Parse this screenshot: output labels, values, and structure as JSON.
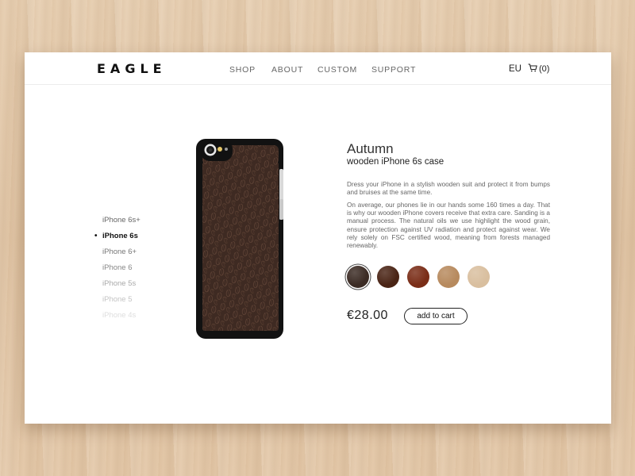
{
  "header": {
    "logo": "EAGLE",
    "nav": [
      "SHOP",
      "ABOUT",
      "CUSTOM",
      "SUPPORT"
    ],
    "region": "EU",
    "cart_count": "(0)"
  },
  "models": [
    {
      "label": "iPhone 6s+",
      "selected": false
    },
    {
      "label": "iPhone 6s",
      "selected": true
    },
    {
      "label": "iPhone 6+",
      "selected": false
    },
    {
      "label": "iPhone 6",
      "selected": false
    },
    {
      "label": "iPhone 5s",
      "selected": false
    },
    {
      "label": "iPhone 5",
      "selected": false
    },
    {
      "label": "iPhone 4s",
      "selected": false
    }
  ],
  "product": {
    "title": "Autumn",
    "subtitle": "wooden iPhone 6s case",
    "description_1": "Dress your iPhone in a stylish wooden suit and protect it from bumps and bruises at the same time.",
    "description_2": "On average, our phones lie in our hands some 160 times a day. That is why our wooden iPhone covers receive that extra care. Sanding is a manual process. The natural oils we use highlight the wood grain, ensure protection against UV radiation and protect against wear. We rely solely on FSC certified wood, meaning from forests managed renewably.",
    "price": "€28.00",
    "add_to_cart": "add to cart"
  },
  "colors": {
    "swatches": [
      "#3b2b24",
      "#4a2415",
      "#7a2d17",
      "#b78a5e",
      "#d9bf9f"
    ],
    "selected_swatch": 0,
    "case_wood": "#3e2a22",
    "case_frame": "#121212"
  }
}
